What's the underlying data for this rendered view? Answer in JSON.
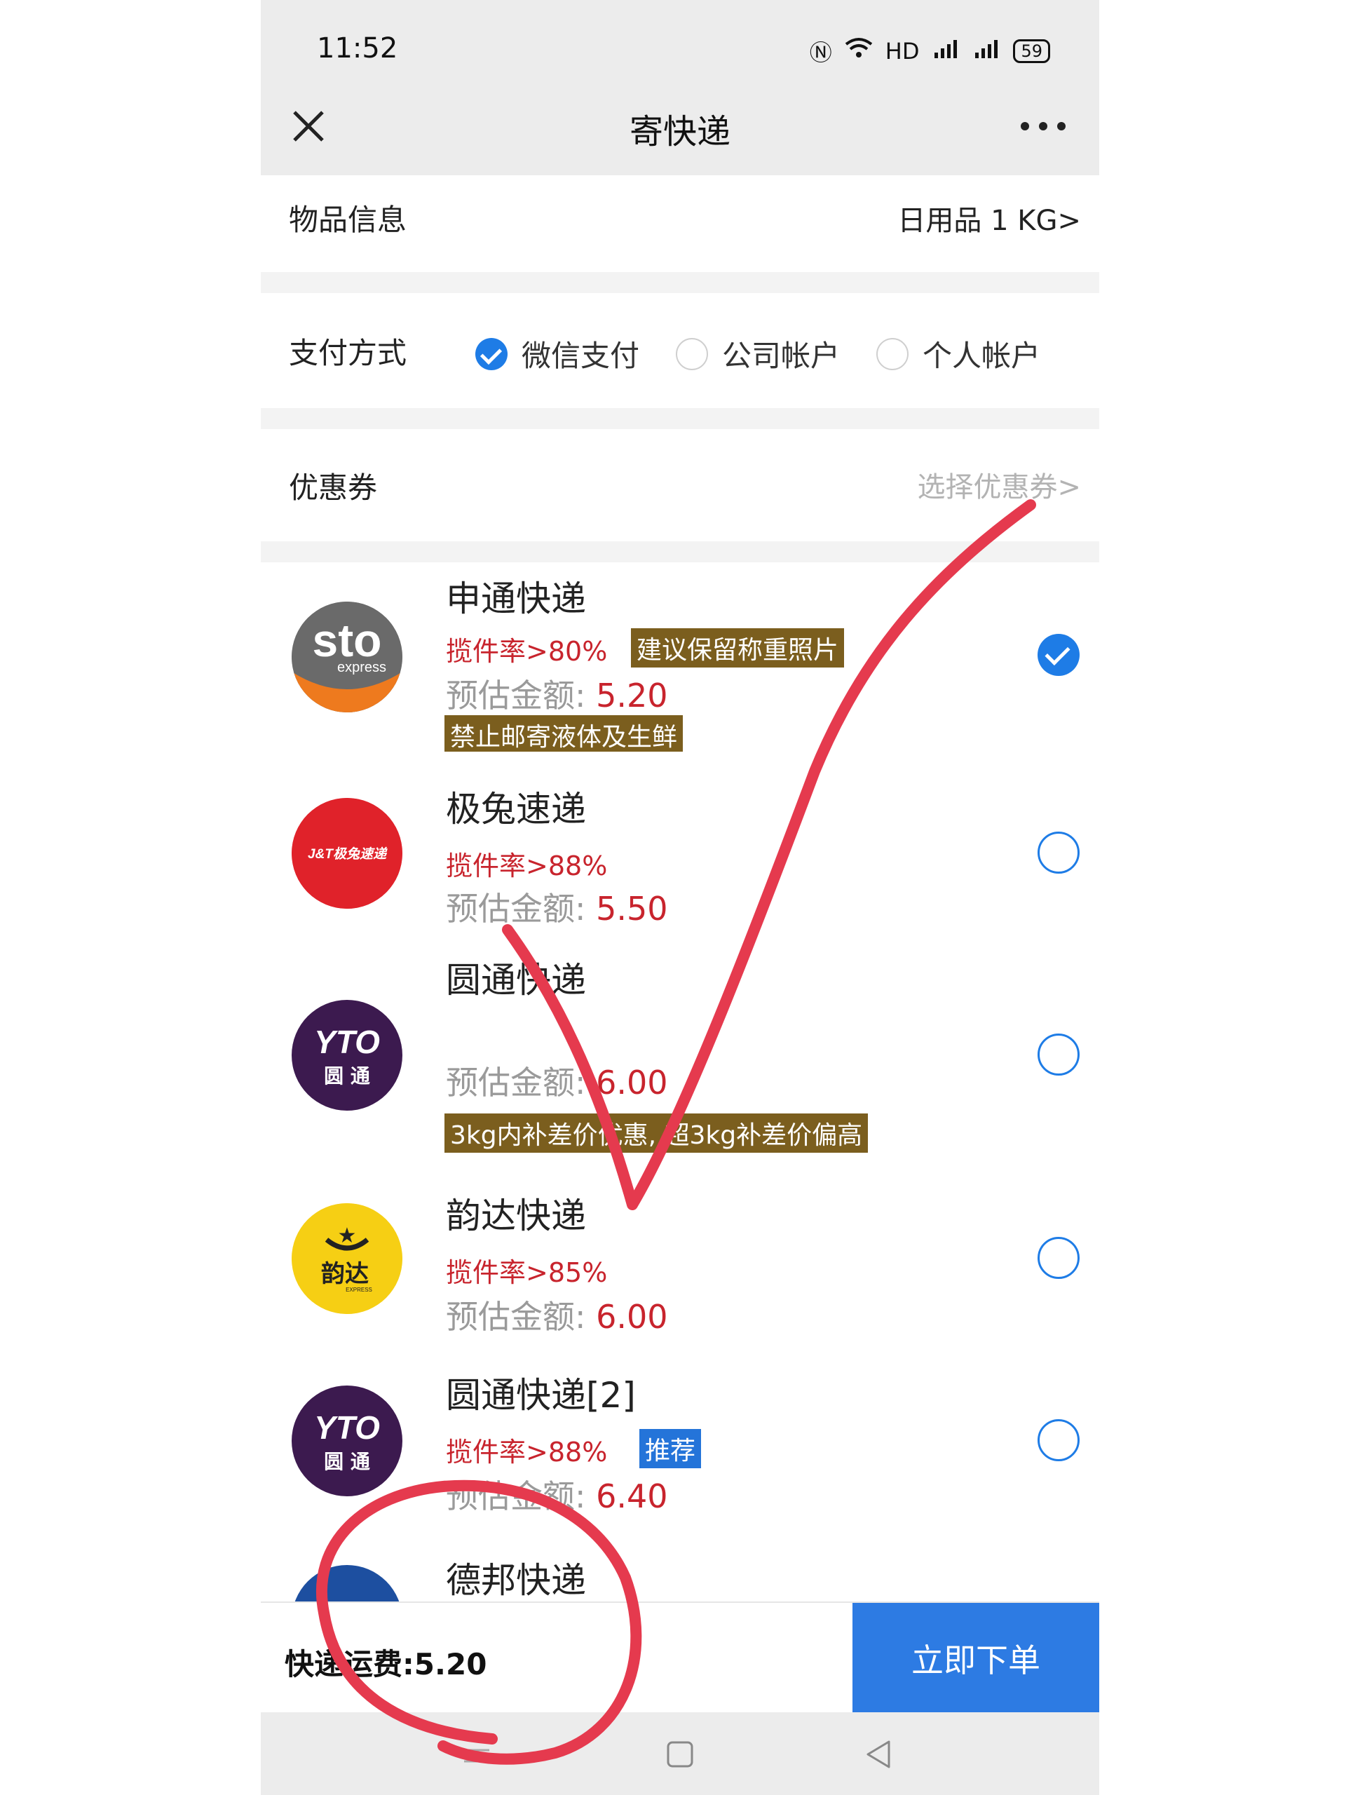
{
  "status_bar": {
    "time": "11:52",
    "signal_label": "HD",
    "battery": "59"
  },
  "header": {
    "title": "寄快递"
  },
  "item_info": {
    "label": "物品信息",
    "value": "日用品 1 KG>"
  },
  "payment": {
    "label": "支付方式",
    "options": [
      {
        "label": "微信支付",
        "selected": true
      },
      {
        "label": "公司帐户",
        "selected": false
      },
      {
        "label": "个人帐户",
        "selected": false
      }
    ]
  },
  "coupon": {
    "label": "优惠券",
    "hint": "选择优惠券>"
  },
  "price_prefix": "预估金额: ",
  "couriers": [
    {
      "name": "申通快递",
      "rate": "揽件率>80%",
      "price": "5.20",
      "tags": [
        "建议保留称重照片",
        "禁止邮寄液体及生鲜"
      ],
      "selected": true,
      "logo_text": "sto",
      "logo_sub": "express"
    },
    {
      "name": "极兔速递",
      "rate": "揽件率>88%",
      "price": "5.50",
      "tags": [],
      "selected": false,
      "logo_text": "J&T极兔速递"
    },
    {
      "name": "圆通快递",
      "rate": "",
      "price": "6.00",
      "tags": [
        "3kg内补差价优惠, 超3kg补差价偏高"
      ],
      "selected": false,
      "logo_text": "YTO",
      "logo_sub": "圆 通"
    },
    {
      "name": "韵达快递",
      "rate": "揽件率>85%",
      "price": "6.00",
      "tags": [],
      "selected": false,
      "logo_text": "韵达",
      "logo_sub": "EXPRESS"
    },
    {
      "name": "圆通快递[2]",
      "rate": "揽件率>88%",
      "price": "6.40",
      "tags": [
        "推荐"
      ],
      "selected": false,
      "logo_text": "YTO",
      "logo_sub": "圆 通"
    },
    {
      "name": "德邦快递",
      "rate": "",
      "price": "",
      "tags": [],
      "selected": false
    }
  ],
  "footer": {
    "fee_label": "快递运费:5.20",
    "order_button": "立即下单"
  },
  "colors": {
    "accent": "#1e7ce6",
    "price_red": "#c8242d",
    "tag_brown": "#7b5e1e",
    "annotation_red": "#e53a4e"
  }
}
